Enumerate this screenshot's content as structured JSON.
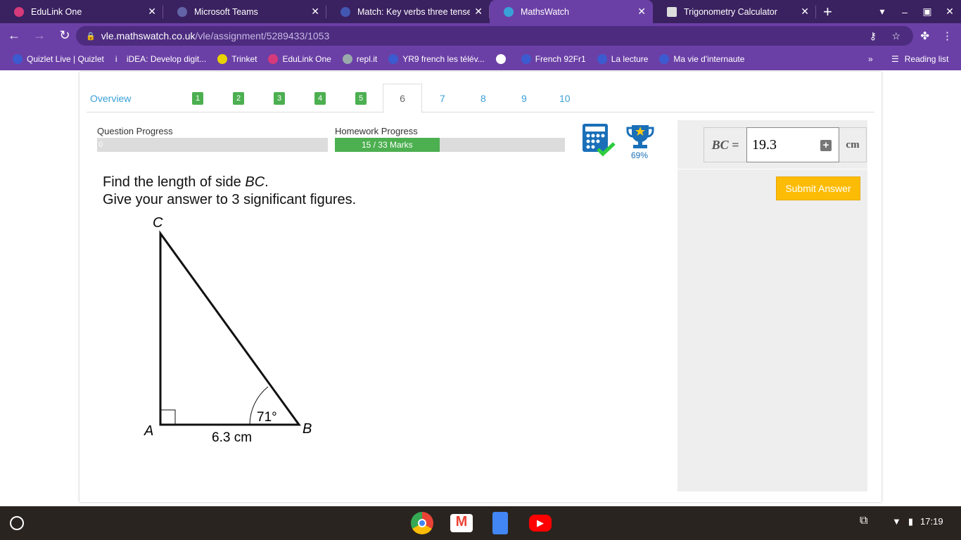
{
  "browser": {
    "tabs": [
      {
        "title": "EduLink One",
        "color": "#d63a7a"
      },
      {
        "title": "Microsoft Teams",
        "color": "#6264a7"
      },
      {
        "title": "Match: Key verbs three tenses",
        "color": "#4257b2"
      },
      {
        "title": "MathsWatch",
        "color": "#3aa0d8",
        "active": true
      },
      {
        "title": "Trigonometry Calculator",
        "color": "#dddddd"
      }
    ],
    "url_host": "vle.mathswatch.co.uk",
    "url_path": "/vle/assignment/5289433/1053",
    "bookmarks": [
      "Quizlet Live | Quizlet",
      "iDEA: Develop digit...",
      "Trinket",
      "EduLink One",
      "repl.it",
      "YR9 french les télév...",
      "",
      "French 92Fr1",
      "La lecture",
      "Ma vie d'internaute"
    ],
    "reading_list": "Reading list"
  },
  "page": {
    "overview": "Overview",
    "questions": [
      "1",
      "2",
      "3",
      "4",
      "5",
      "6",
      "7",
      "8",
      "9",
      "10"
    ],
    "current_question": "6",
    "question_progress_label": "Question Progress",
    "question_progress_value": "0",
    "homework_progress_label": "Homework Progress",
    "homework_progress_text": "15 / 33 Marks",
    "homework_fraction": 0.4545,
    "trophy_percent": "69%",
    "question_line1_pre": "Find the length of side ",
    "question_line1_var": "BC",
    "question_line1_post": ".",
    "question_line2": "Give your answer to 3 significant figures.",
    "diagram": {
      "A": "A",
      "B": "B",
      "C": "C",
      "angle": "71°",
      "base": "6.3 cm"
    },
    "answer_label": "BC =",
    "answer_value": "19.3",
    "answer_unit": "cm",
    "submit": "Submit Answer"
  },
  "taskbar": {
    "time": "17:19"
  }
}
